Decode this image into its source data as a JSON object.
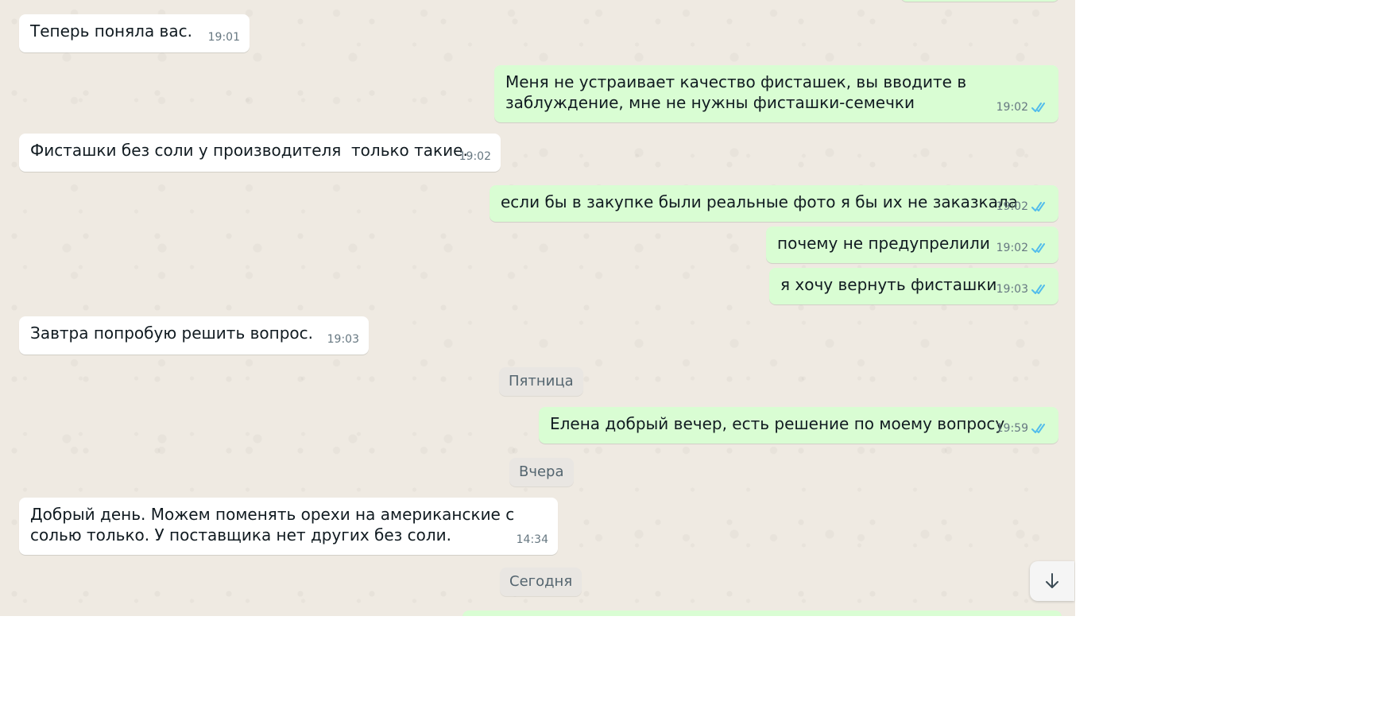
{
  "messages": [
    {
      "dir": "in",
      "text": "Теперь поняла вас.",
      "time": "19:01"
    },
    {
      "dir": "out",
      "text": "Меня не устраивает качество фисташек, вы вводите в заблуждение, мне не нужны фисташки-семечки",
      "time": "19:02",
      "read": true
    },
    {
      "dir": "in",
      "text": "Фисташки без соли у производителя  только такие.",
      "time": "19:02"
    },
    {
      "dir": "out",
      "text": "если бы в закупке были реальные фото я бы их не заказкала",
      "time": "19:02",
      "read": true
    },
    {
      "dir": "out",
      "text": "почему не предупрелили",
      "time": "19:02",
      "read": true
    },
    {
      "dir": "out",
      "text": "я хочу вернуть фисташки",
      "time": "19:03",
      "read": true
    },
    {
      "dir": "in",
      "text": "Завтра попробую решить вопрос.",
      "time": "19:03"
    },
    {
      "dir": "out",
      "text": "Елена добрый вечер, есть решение по моему вопросу",
      "time": "19:59",
      "read": true
    },
    {
      "dir": "in",
      "text": "Добрый день. Можем поменять орехи на американские с солью только. У поставщика нет других без соли.",
      "time": "14:34"
    }
  ],
  "date_chips": [
    "Пятница",
    "Вчера",
    "Сегодня"
  ],
  "icons": {
    "read_receipt": "double-check-icon",
    "scroll_down": "arrow-down-icon"
  },
  "colors": {
    "incoming": "#ffffff",
    "outgoing": "#d9fdd3",
    "read_check": "#53bdeb",
    "wallpaper": "#efeae2"
  }
}
